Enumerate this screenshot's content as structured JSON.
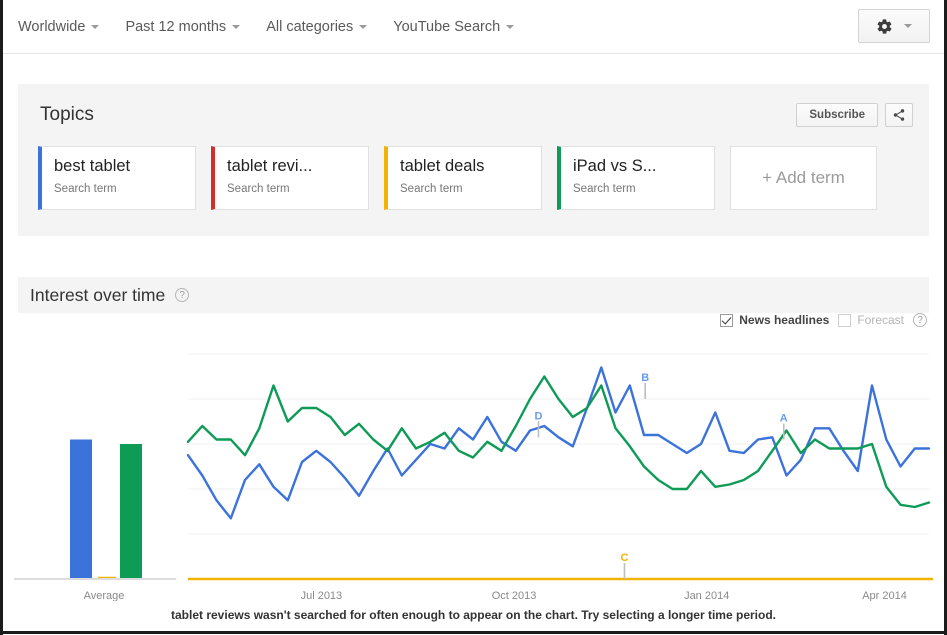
{
  "topnav": {
    "items": [
      {
        "label": "Worldwide"
      },
      {
        "label": "Past 12 months"
      },
      {
        "label": "All categories"
      },
      {
        "label": "YouTube Search"
      }
    ],
    "settings_icon": "gear-icon",
    "settings_caret": "chevron-down-icon"
  },
  "topics": {
    "title": "Topics",
    "subscribe_label": "Subscribe",
    "share_icon": "share-icon",
    "terms": [
      {
        "name": "best tablet",
        "type": "Search term",
        "color": "#3B73DB"
      },
      {
        "name": "tablet revi...",
        "type": "Search term",
        "color": "#D32F2B"
      },
      {
        "name": "tablet deals",
        "type": "Search term",
        "color": "#F2B307"
      },
      {
        "name": "iPad vs S...",
        "type": "Search term",
        "color": "#0E9B56"
      }
    ],
    "add_term_label": "+ Add term"
  },
  "interest": {
    "title": "Interest over time",
    "help_icon": "help-circle-icon",
    "options": [
      {
        "label": "News headlines",
        "checked": true,
        "disabled": false
      },
      {
        "label": "Forecast",
        "checked": false,
        "disabled": true
      }
    ],
    "forecast_help_icon": "help-circle-icon",
    "footer_note": "tablet reviews wasn't searched for often enough to appear on the chart. Try selecting a longer time period."
  },
  "chart_data": {
    "type": "line",
    "title": "Interest over time",
    "xlabel": "",
    "ylabel": "",
    "ylim": [
      0,
      100
    ],
    "grid": true,
    "legend_position": "none",
    "average_label": "Average",
    "averages": [
      {
        "name": "best tablet",
        "value": 62,
        "color": "#3B73DB"
      },
      {
        "name": "tablet reviews",
        "value": 1,
        "color": "#F2B307"
      },
      {
        "name": "iPad vs Surface",
        "value": 60,
        "color": "#0E9B56"
      }
    ],
    "tick_labels": [
      "Jul 2013",
      "Oct 2013",
      "Jan 2014",
      "Apr 2014"
    ],
    "tick_positions": [
      0.18,
      0.44,
      0.7,
      0.94
    ],
    "annotations": [
      {
        "label": "D",
        "x": 0.473,
        "y": 63,
        "color": "#6A9CEC"
      },
      {
        "label": "B",
        "x": 0.617,
        "y": 80,
        "color": "#6A9CEC"
      },
      {
        "label": "C",
        "x": 0.589,
        "y": 0,
        "color": "#F2B307"
      },
      {
        "label": "A",
        "x": 0.804,
        "y": 62,
        "color": "#6A9CEC"
      }
    ],
    "series": [
      {
        "name": "best tablet",
        "color": "#3B73DB",
        "values": [
          55,
          46,
          35,
          27,
          44,
          51,
          41,
          35,
          52,
          57,
          52,
          45,
          37,
          48,
          58,
          46,
          53,
          60,
          58,
          67,
          62,
          72,
          61,
          57,
          66,
          68,
          63,
          59,
          76,
          94,
          74,
          86,
          64,
          64,
          60,
          56,
          60,
          74,
          57,
          56,
          62,
          63,
          46,
          53,
          67,
          67,
          57,
          48,
          86,
          62,
          50,
          58,
          58
        ]
      },
      {
        "name": "tablet reviews",
        "color": "#F2B307",
        "values": [
          0,
          0,
          0,
          0,
          0,
          0,
          0,
          0,
          0,
          0,
          0,
          0,
          0,
          0,
          0,
          0,
          0,
          0,
          0,
          0,
          0,
          0,
          0,
          0,
          0,
          0,
          0,
          0,
          0,
          0,
          0,
          0,
          0,
          0,
          0,
          0,
          0,
          0,
          0,
          0,
          0,
          0,
          0,
          0,
          0,
          0,
          0,
          0,
          0,
          0,
          0,
          0,
          0
        ]
      },
      {
        "name": "iPad vs Surface",
        "color": "#0E9B56",
        "values": [
          61,
          68,
          62,
          62,
          55,
          67,
          86,
          70,
          76,
          76,
          72,
          64,
          69,
          62,
          57,
          67,
          58,
          61,
          65,
          57,
          54,
          61,
          57,
          68,
          80,
          90,
          80,
          72,
          76,
          86,
          67,
          59,
          50,
          44,
          40,
          40,
          48,
          41,
          42,
          44,
          48,
          57,
          66,
          56,
          62,
          58,
          58,
          58,
          60,
          41,
          33,
          32,
          34
        ]
      }
    ]
  }
}
